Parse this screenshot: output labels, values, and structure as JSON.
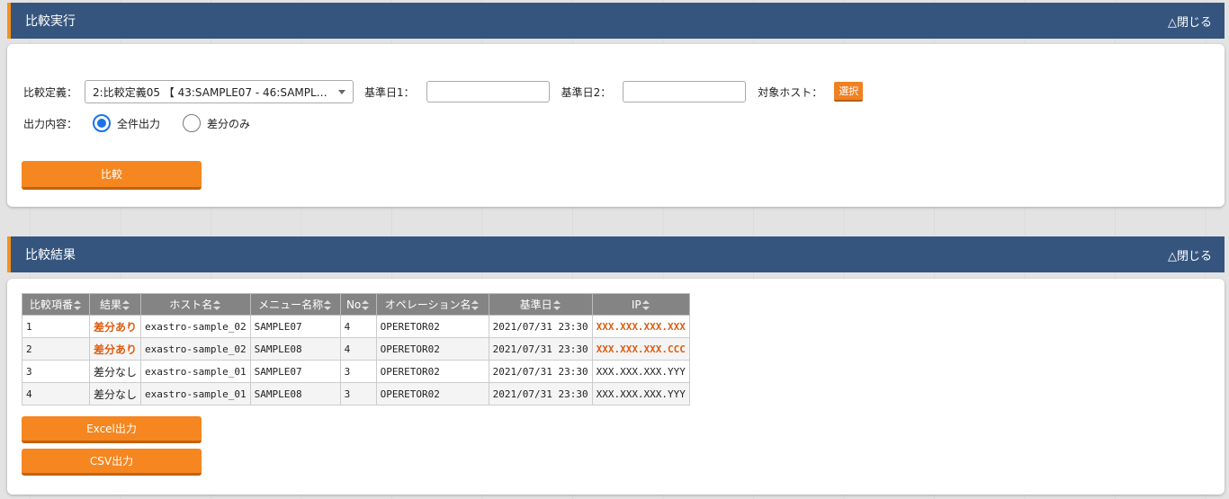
{
  "compare_exec": {
    "title": "比較実行",
    "toggle": "△閉じる",
    "definition_label": "比較定義：",
    "definition_value": "2:比較定義05 【 43:SAMPLE07 - 46:SAMPL…",
    "base_date1_label": "基準日1：",
    "base_date1_value": "",
    "base_date2_label": "基準日2：",
    "base_date2_value": "",
    "target_host_label": "対象ホスト：",
    "select_button": "選択",
    "output_label": "出力内容：",
    "radio_all": "全件出力",
    "radio_diff": "差分のみ",
    "selected_output": "全件出力",
    "compare_button": "比較"
  },
  "compare_result": {
    "title": "比較結果",
    "toggle": "△閉じる",
    "columns": [
      "比較項番",
      "結果",
      "ホスト名",
      "メニュー名称",
      "No",
      "オペレーション名",
      "基準日",
      "IP"
    ],
    "rows": [
      {
        "no": "1",
        "result": "差分あり",
        "host": "exastro-sample_02",
        "menu": "SAMPLE07",
        "num": "4",
        "operation": "OPERETOR02",
        "date": "2021/07/31 23:30",
        "ip": "XXX.XXX.XXX.XXX"
      },
      {
        "no": "2",
        "result": "差分あり",
        "host": "exastro-sample_02",
        "menu": "SAMPLE08",
        "num": "4",
        "operation": "OPERETOR02",
        "date": "2021/07/31 23:30",
        "ip": "XXX.XXX.XXX.CCC"
      },
      {
        "no": "3",
        "result": "差分なし",
        "host": "exastro-sample_01",
        "menu": "SAMPLE07",
        "num": "3",
        "operation": "OPERETOR02",
        "date": "2021/07/31 23:30",
        "ip": "XXX.XXX.XXX.YYY"
      },
      {
        "no": "4",
        "result": "差分なし",
        "host": "exastro-sample_01",
        "menu": "SAMPLE08",
        "num": "3",
        "operation": "OPERETOR02",
        "date": "2021/07/31 23:30",
        "ip": "XXX.XXX.XXX.YYY"
      }
    ],
    "excel_button": "Excel出力",
    "csv_button": "CSV出力"
  },
  "colors": {
    "header_bg": "#35557e",
    "accent": "#f58620",
    "diff_text": "#e05c10"
  }
}
